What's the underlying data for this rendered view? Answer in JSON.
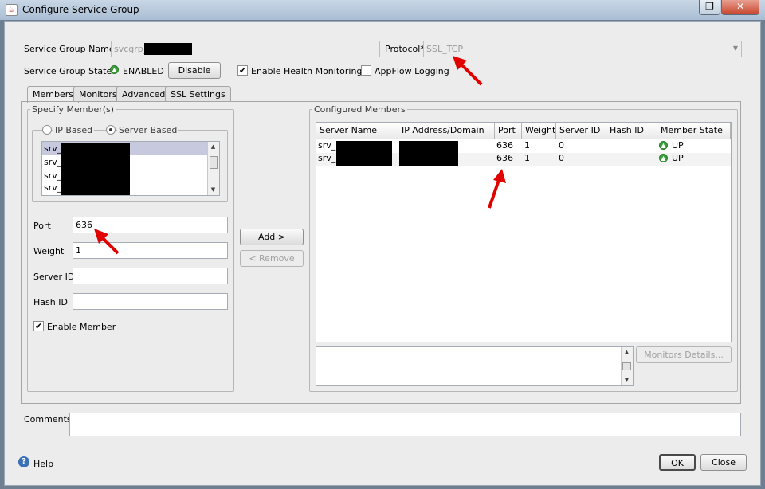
{
  "window": {
    "title": "Configure Service Group"
  },
  "header": {
    "name_label": "Service Group Name*",
    "name_value": "svcgrp_",
    "protocol_label": "Protocol*",
    "protocol_value": "SSL_TCP",
    "state_label": "Service Group State",
    "state_value": "ENABLED",
    "disable_button": "Disable",
    "health_monitoring_label": "Enable Health Monitoring",
    "health_monitoring_checked": true,
    "appflow_label": "AppFlow Logging",
    "appflow_checked": false
  },
  "tabs": [
    {
      "label": "Members"
    },
    {
      "label": "Monitors"
    },
    {
      "label": "Advanced"
    },
    {
      "label": "SSL Settings"
    }
  ],
  "specify": {
    "legend": "Specify Member(s)",
    "ip_based": "IP Based",
    "server_based": "Server Based",
    "servers": [
      "srv_",
      "srv_",
      "srv_",
      "srv_"
    ],
    "port_label": "Port",
    "port_value": "636",
    "weight_label": "Weight",
    "weight_value": "1",
    "server_id_label": "Server ID",
    "server_id_value": "",
    "hash_id_label": "Hash ID",
    "hash_id_value": "",
    "enable_member_label": "Enable Member",
    "enable_member_checked": true
  },
  "actions": {
    "add": "Add >",
    "remove": "< Remove"
  },
  "configured": {
    "legend": "Configured Members",
    "columns": [
      "Server Name",
      "IP Address/Domain",
      "Port",
      "Weight",
      "Server ID",
      "Hash ID",
      "Member State"
    ],
    "rows": [
      {
        "server": "srv_",
        "ip": "",
        "port": "636",
        "weight": "1",
        "server_id": "0",
        "hash_id": "",
        "state": "UP"
      },
      {
        "server": "srv_",
        "ip": "",
        "port": "636",
        "weight": "1",
        "server_id": "0",
        "hash_id": "",
        "state": "UP"
      }
    ],
    "monitors_details": "Monitors Details..."
  },
  "comments": {
    "label": "Comments",
    "value": ""
  },
  "footer": {
    "help": "Help",
    "ok": "OK",
    "close": "Close"
  },
  "colors": {
    "accent": "#2e8b2e",
    "annotation": "#e00000"
  }
}
